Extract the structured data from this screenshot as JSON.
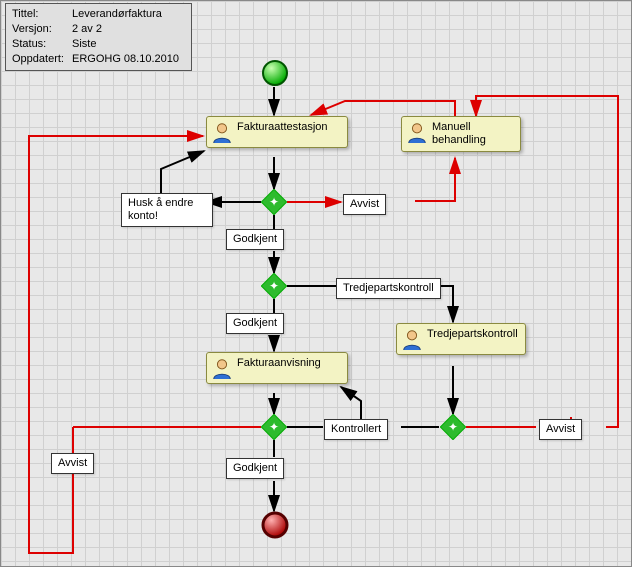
{
  "info": {
    "title_label": "Tittel:",
    "title_value": "Leverandørfaktura",
    "version_label": "Versjon:",
    "version_value": "2 av 2",
    "status_label": "Status:",
    "status_value": "Siste",
    "updated_label": "Oppdatert:",
    "updated_value": "ERGOHG 08.10.2010"
  },
  "tasks": {
    "fakturaattestasjon": "Fakturaattestasjon",
    "manuell": "Manuell behandling",
    "fakturaanvisning": "Fakturaanvisning",
    "tredjepartskontroll_task": "Tredjepartskontroll"
  },
  "labels": {
    "husk": "Husk å endre konto!",
    "avvist": "Avvist",
    "godkjent": "Godkjent",
    "tredjepartskontroll": "Tredjepartskontroll",
    "kontrollert": "Kontrollert"
  },
  "icons": {
    "user": "user-icon",
    "start": "start-event-icon",
    "end": "end-event-icon",
    "gateway": "gateway-icon"
  }
}
